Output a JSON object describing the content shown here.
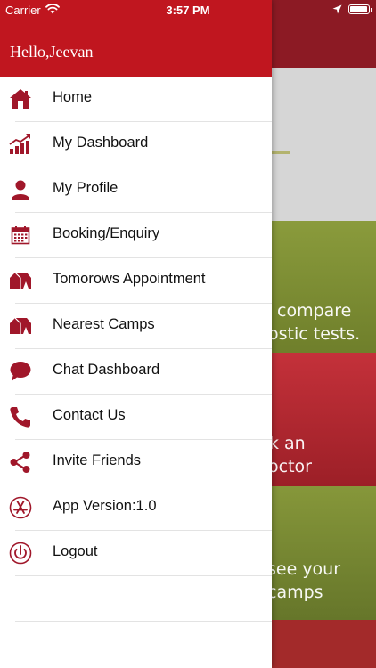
{
  "status_bar": {
    "carrier": "Carrier",
    "time": "3:57 PM"
  },
  "drawer": {
    "greeting": "Hello,Jeevan",
    "accent_color": "#c0161f",
    "icon_color": "#a0172a",
    "items": [
      {
        "label": "Home",
        "icon": "house-icon"
      },
      {
        "label": "My Dashboard",
        "icon": "bar-chart-icon"
      },
      {
        "label": "My Profile",
        "icon": "person-icon"
      },
      {
        "label": "Booking/Enquiry",
        "icon": "calendar-icon"
      },
      {
        "label": "Tomorows Appointment",
        "icon": "camp-tent-icon"
      },
      {
        "label": "Nearest Camps",
        "icon": "camp-tent-icon"
      },
      {
        "label": "Chat Dashboard",
        "icon": "chat-bubble-icon"
      },
      {
        "label": "Contact Us",
        "icon": "phone-icon"
      },
      {
        "label": "Invite Friends",
        "icon": "share-icon"
      },
      {
        "label": "App Version:1.0",
        "icon": "app-store-icon"
      },
      {
        "label": "Logout",
        "icon": "power-icon"
      }
    ]
  },
  "background": {
    "panel1_lines": [
      "compare",
      "ostic tests."
    ],
    "panel2_lines": [
      "k an",
      "octor"
    ],
    "panel3_lines": [
      "see your",
      "camps"
    ]
  }
}
